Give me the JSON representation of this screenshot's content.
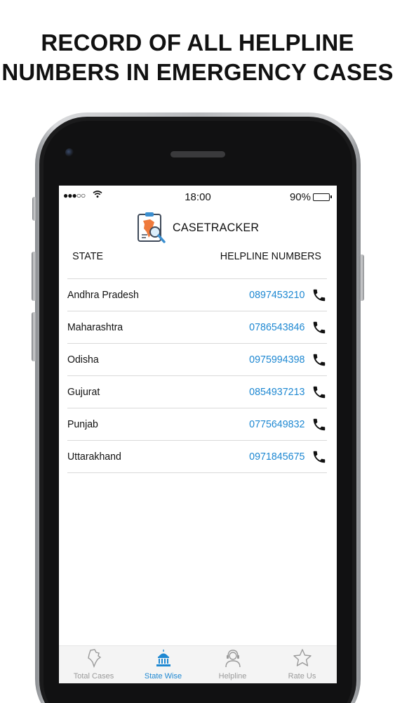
{
  "headline": {
    "line1": "RECORD OF ALL HELPLINE",
    "line2": "NUMBERS IN EMERGENCY CASES"
  },
  "status_bar": {
    "signal": "●●●○○",
    "wifi_icon": "wifi-icon",
    "time": "18:00",
    "battery_text": "90%",
    "battery_level": 0.9
  },
  "app": {
    "title": "CASETRACKER",
    "logo_icon": "casetracker-logo-icon"
  },
  "table": {
    "col_state": "STATE",
    "col_helpline": "HELPLINE NUMBERS",
    "rows": [
      {
        "state": "Andhra Pradesh",
        "number": "0897453210"
      },
      {
        "state": "Maharashtra",
        "number": "0786543846"
      },
      {
        "state": "Odisha",
        "number": "0975994398"
      },
      {
        "state": "Gujurat",
        "number": "0854937213"
      },
      {
        "state": "Punjab",
        "number": "0775649832"
      },
      {
        "state": "Uttarakhand",
        "number": "0971845675"
      }
    ]
  },
  "tabbar": {
    "tabs": [
      {
        "label": "Total Cases",
        "icon": "india-map-icon",
        "active": false
      },
      {
        "label": "State Wise",
        "icon": "government-building-icon",
        "active": true
      },
      {
        "label": "Helpline",
        "icon": "headset-agent-icon",
        "active": false
      },
      {
        "label": "Rate Us",
        "icon": "star-icon",
        "active": false
      }
    ]
  },
  "colors": {
    "accent": "#1e88d2",
    "text": "#111111",
    "divider": "#d9d9d9",
    "tab_inactive": "#9a9a9a"
  }
}
